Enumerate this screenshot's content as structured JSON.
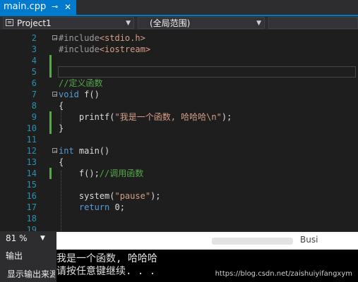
{
  "tab": {
    "title": "main.cpp",
    "pin_glyph": "⊸",
    "close_glyph": "✕"
  },
  "navbar": {
    "project": "Project1",
    "scope": "(全局范围)"
  },
  "editor": {
    "lines": [
      {
        "n": "2",
        "fold": "−",
        "tokens": [
          {
            "t": "#include",
            "c": "pp"
          },
          {
            "t": "<stdio.h>",
            "c": "str"
          }
        ]
      },
      {
        "n": "3",
        "fold": "",
        "tokens": [
          {
            "t": "#include",
            "c": "pp"
          },
          {
            "t": "<iostream>",
            "c": "str"
          }
        ]
      },
      {
        "n": "4",
        "fold": "",
        "changed": true,
        "tokens": []
      },
      {
        "n": "5",
        "fold": "",
        "changed": true,
        "current": true,
        "tokens": []
      },
      {
        "n": "6",
        "fold": "",
        "tokens": [
          {
            "t": "//定义函数",
            "c": "cm"
          }
        ]
      },
      {
        "n": "7",
        "fold": "−",
        "tokens": [
          {
            "t": "void",
            "c": "kw"
          },
          {
            "t": " f()",
            "c": ""
          }
        ]
      },
      {
        "n": "8",
        "fold": "",
        "tokens": [
          {
            "t": "{",
            "c": ""
          }
        ]
      },
      {
        "n": "9",
        "fold": "",
        "changed": true,
        "tokens": [
          {
            "t": "    printf(",
            "c": ""
          },
          {
            "t": "\"我是一个函数, 哈哈哈\\n\"",
            "c": "str"
          },
          {
            "t": ");",
            "c": ""
          }
        ]
      },
      {
        "n": "10",
        "fold": "",
        "changed": true,
        "tokens": [
          {
            "t": "}",
            "c": ""
          }
        ]
      },
      {
        "n": "11",
        "fold": "",
        "tokens": []
      },
      {
        "n": "12",
        "fold": "−",
        "tokens": [
          {
            "t": "int",
            "c": "kw"
          },
          {
            "t": " main()",
            "c": ""
          }
        ]
      },
      {
        "n": "13",
        "fold": "",
        "tokens": [
          {
            "t": "{",
            "c": ""
          }
        ]
      },
      {
        "n": "14",
        "fold": "",
        "changed": true,
        "tokens": [
          {
            "t": "    f();",
            "c": ""
          },
          {
            "t": "//调用函数",
            "c": "cm"
          }
        ]
      },
      {
        "n": "15",
        "fold": "",
        "tokens": []
      },
      {
        "n": "16",
        "fold": "",
        "tokens": [
          {
            "t": "    system(",
            "c": ""
          },
          {
            "t": "\"pause\"",
            "c": "str"
          },
          {
            "t": ");",
            "c": ""
          }
        ]
      },
      {
        "n": "17",
        "fold": "",
        "tokens": [
          {
            "t": "    ",
            "c": ""
          },
          {
            "t": "return",
            "c": "kw"
          },
          {
            "t": " 0;",
            "c": ""
          }
        ]
      },
      {
        "n": "18",
        "fold": "",
        "tokens": []
      },
      {
        "n": "19",
        "fold": "",
        "tokens": []
      }
    ]
  },
  "status": {
    "zoom": "81 %"
  },
  "output": {
    "title": "输出",
    "source_label": "显示输出来源"
  },
  "console": {
    "window_fragment": "Busi",
    "lines": [
      "我是一个函数, 哈哈哈",
      "请按任意键继续. . ."
    ]
  },
  "watermark": "https://blog.csdn.net/zaishuiyifangxym",
  "colors": {
    "accent": "#007acc",
    "keyword": "#569cd6",
    "string": "#d69d85",
    "comment": "#57a64a",
    "line_number": "#2b91af"
  }
}
